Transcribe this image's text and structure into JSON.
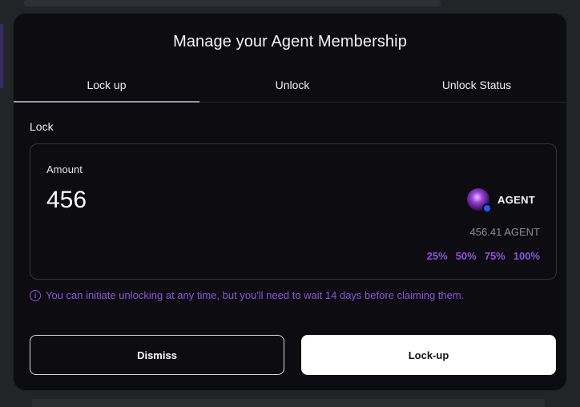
{
  "modal": {
    "title": "Manage your Agent Membership",
    "tabs": [
      {
        "label": "Lock up",
        "active": true
      },
      {
        "label": "Unlock",
        "active": false
      },
      {
        "label": "Unlock Status",
        "active": false
      }
    ]
  },
  "lock": {
    "section_label": "Lock",
    "amount_label": "Amount",
    "amount_value": "456",
    "token_symbol": "AGENT",
    "token_icon": "agent-token-avatar-icon",
    "balance_text": "456.41 AGENT",
    "percent_options": [
      "25%",
      "50%",
      "75%",
      "100%"
    ]
  },
  "info": {
    "icon": "info-icon",
    "text": "You can initiate unlocking at any time, but you'll need to wait 14 days before claiming them."
  },
  "buttons": {
    "dismiss_label": "Dismiss",
    "lockup_label": "Lock-up"
  },
  "colors": {
    "accent": "#8a55e0",
    "modal_bg": "#0d0c11",
    "primary_button_bg": "#ffffff"
  }
}
